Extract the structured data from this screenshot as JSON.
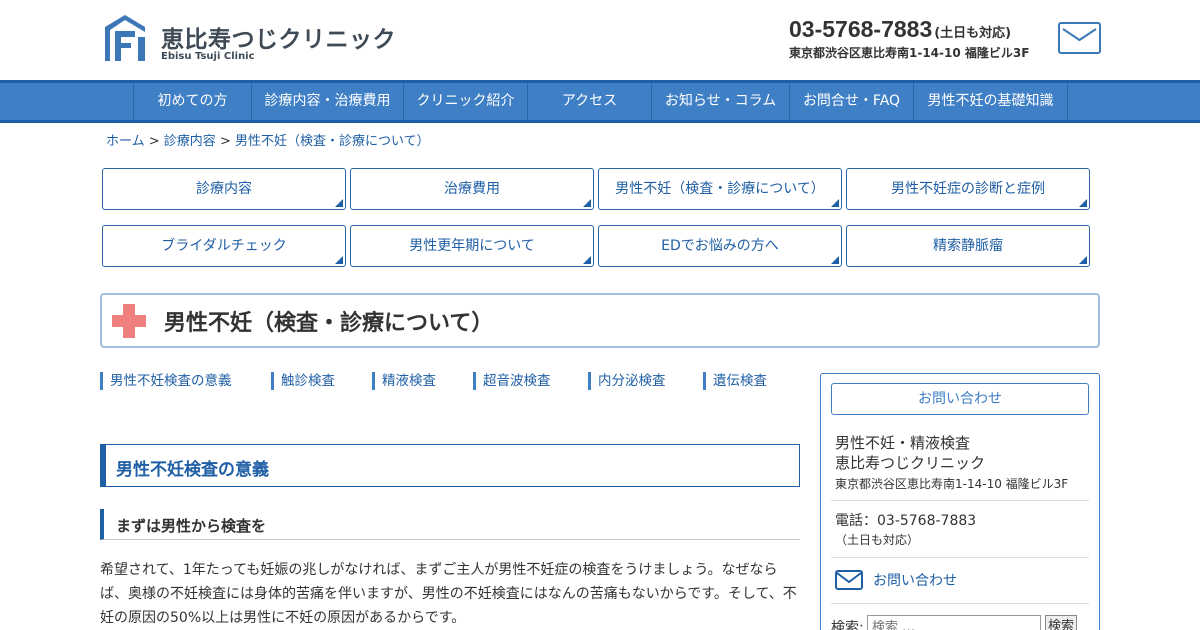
{
  "header": {
    "logo_text": "恵比寿つじクリニック",
    "logo_sub": "Ebisu Tsuji Clinic",
    "tel": "03-5768-7883",
    "tel_note": "(土日も対応)",
    "address": "東京都渋谷区恵比寿南1-14-10 福隆ビル3F"
  },
  "nav": {
    "items": [
      {
        "label": "初めての方"
      },
      {
        "label": "診療内容・治療費用"
      },
      {
        "label": "クリニック紹介"
      },
      {
        "label": "アクセス"
      },
      {
        "label": "お知らせ・コラム"
      },
      {
        "label": "お問合せ・FAQ"
      },
      {
        "label": "男性不妊の基礎知識"
      }
    ]
  },
  "breadcrumb": {
    "home": "ホーム",
    "sep": " > ",
    "parent": "診療内容",
    "current": "男性不妊（検査・診療について）"
  },
  "submenu": {
    "items": [
      {
        "label": "診療内容"
      },
      {
        "label": "治療費用"
      },
      {
        "label": "男性不妊（検査・診療について）"
      },
      {
        "label": "男性不妊症の診断と症例"
      },
      {
        "label": "ブライダルチェック"
      },
      {
        "label": "男性更年期について"
      },
      {
        "label": "EDでお悩みの方へ"
      },
      {
        "label": "精索静脈瘤"
      }
    ]
  },
  "page": {
    "title": "男性不妊（検査・診療について）"
  },
  "anchors": {
    "items": [
      {
        "label": "男性不妊検査の意義"
      },
      {
        "label": "触診検査"
      },
      {
        "label": "精液検査"
      },
      {
        "label": "超音波検査"
      },
      {
        "label": "内分泌検査"
      },
      {
        "label": "遺伝検査"
      }
    ]
  },
  "main": {
    "h2": "男性不妊検査の意義",
    "h3": "まずは男性から検査を",
    "paragraph": "希望されて、1年たっても妊娠の兆しがなければ、まずご主人が男性不妊症の検査をうけましょう。なぜならば、奥様の不妊検査には身体的苦痛を伴いますが、男性の不妊検査にはなんの苦痛もないからです。そして、不妊の原因の50%以上は男性に不妊の原因があるからです。"
  },
  "sidebar": {
    "contact_btn": "お問い合わせ",
    "name1": "男性不妊・精液検査",
    "name2": "恵比寿つじクリニック",
    "address": "東京都渋谷区恵比寿南1-14-10 福隆ビル3F",
    "tel": "電話：03-5768-7883",
    "tel_note": "（土日も対応）",
    "mail_link": "お問い合わせ",
    "search_label": "検索:",
    "search_placeholder": "検索 …",
    "search_btn": "検索"
  },
  "colors": {
    "brand_blue": "#1f5fa5",
    "nav_blue": "#3f7fc6",
    "cross_red": "#f08080"
  }
}
